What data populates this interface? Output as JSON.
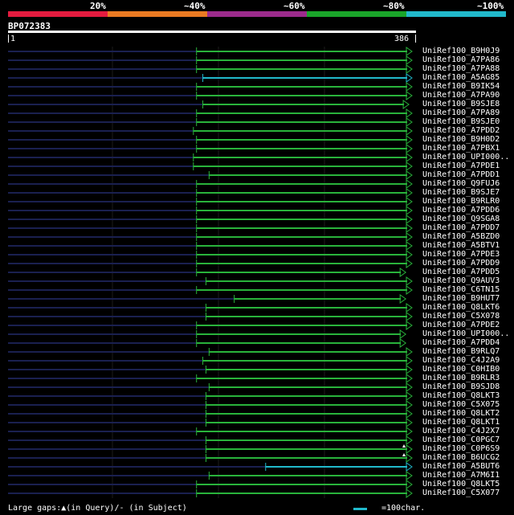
{
  "colors": {
    "scale": [
      "#e31b3f",
      "#ea7a22",
      "#9c2b8c",
      "#1aa52a",
      "#21b9cb"
    ],
    "hit_green": "#29b33b",
    "hit_cyan": "#21b9cb",
    "track": "#1a2050"
  },
  "scale_labels": [
    "20%",
    "~40%",
    "~60%",
    "~80%",
    "~100%"
  ],
  "query": {
    "id": "BP072383",
    "start": "1",
    "end": "386"
  },
  "hits": [
    {
      "name": "UniRef100_B9H0J9",
      "start": 181,
      "end": 386,
      "color": "green",
      "arrow": "right"
    },
    {
      "name": "UniRef100_A7PA86",
      "start": 181,
      "end": 386,
      "color": "green",
      "arrow": "right"
    },
    {
      "name": "UniRef100_A7PA88",
      "start": 181,
      "end": 386,
      "color": "green",
      "arrow": "right"
    },
    {
      "name": "UniRef100_A5AG85",
      "start": 187,
      "end": 386,
      "color": "cyan",
      "arrow": "right"
    },
    {
      "name": "UniRef100_B9IK54",
      "start": 181,
      "end": 386,
      "color": "green",
      "arrow": "right"
    },
    {
      "name": "UniRef100_A7PA90",
      "start": 181,
      "end": 386,
      "color": "green",
      "arrow": "right"
    },
    {
      "name": "UniRef100_B9SJE8",
      "start": 187,
      "end": 383,
      "color": "green",
      "arrow": "right"
    },
    {
      "name": "UniRef100_A7PA89",
      "start": 181,
      "end": 386,
      "color": "green",
      "arrow": "right"
    },
    {
      "name": "UniRef100_B9SJE0",
      "start": 181,
      "end": 386,
      "color": "green",
      "arrow": "right"
    },
    {
      "name": "UniRef100_A7PDD2",
      "start": 178,
      "end": 386,
      "color": "green",
      "arrow": "right"
    },
    {
      "name": "UniRef100_B9H0D2",
      "start": 181,
      "end": 386,
      "color": "green",
      "arrow": "right"
    },
    {
      "name": "UniRef100_A7PBX1",
      "start": 181,
      "end": 386,
      "color": "green",
      "arrow": "right"
    },
    {
      "name": "UniRef100_UPI000..",
      "start": 178,
      "end": 386,
      "color": "green",
      "arrow": "right"
    },
    {
      "name": "UniRef100_A7PDE1",
      "start": 178,
      "end": 386,
      "color": "green",
      "arrow": "right"
    },
    {
      "name": "UniRef100_A7PDD1",
      "start": 193,
      "end": 386,
      "color": "green",
      "arrow": "right"
    },
    {
      "name": "UniRef100_Q9FUJ6",
      "start": 181,
      "end": 386,
      "color": "green",
      "arrow": "right"
    },
    {
      "name": "UniRef100_B9SJE7",
      "start": 181,
      "end": 386,
      "color": "green",
      "arrow": "right"
    },
    {
      "name": "UniRef100_B9RLR0",
      "start": 181,
      "end": 386,
      "color": "green",
      "arrow": "right"
    },
    {
      "name": "UniRef100_A7PDD6",
      "start": 181,
      "end": 386,
      "color": "green",
      "arrow": "right"
    },
    {
      "name": "UniRef100_Q9SGA8",
      "start": 181,
      "end": 386,
      "color": "green",
      "arrow": "right"
    },
    {
      "name": "UniRef100_A7PDD7",
      "start": 181,
      "end": 386,
      "color": "green",
      "arrow": "right"
    },
    {
      "name": "UniRef100_A5BZD0",
      "start": 181,
      "end": 386,
      "color": "green",
      "arrow": "right"
    },
    {
      "name": "UniRef100_A5BTV1",
      "start": 181,
      "end": 386,
      "color": "green",
      "arrow": "right"
    },
    {
      "name": "UniRef100_A7PDE3",
      "start": 181,
      "end": 386,
      "color": "green",
      "arrow": "right"
    },
    {
      "name": "UniRef100_A7PDD9",
      "start": 181,
      "end": 386,
      "color": "green",
      "arrow": "right"
    },
    {
      "name": "UniRef100_A7PDD5",
      "start": 181,
      "end": 380,
      "color": "green",
      "arrow": "right"
    },
    {
      "name": "UniRef100_Q9AUV3",
      "start": 190,
      "end": 386,
      "color": "green",
      "arrow": "right"
    },
    {
      "name": "UniRef100_C6TN15",
      "start": 181,
      "end": 386,
      "color": "green",
      "arrow": "right"
    },
    {
      "name": "UniRef100_B9HUT7",
      "start": 217,
      "end": 380,
      "color": "green",
      "arrow": "right"
    },
    {
      "name": "UniRef100_Q8LKT6",
      "start": 190,
      "end": 386,
      "color": "green",
      "arrow": "right"
    },
    {
      "name": "UniRef100_C5X078",
      "start": 190,
      "end": 386,
      "color": "green",
      "arrow": "right"
    },
    {
      "name": "UniRef100_A7PDE2",
      "start": 181,
      "end": 386,
      "color": "green",
      "arrow": "right"
    },
    {
      "name": "UniRef100_UPI000..",
      "start": 181,
      "end": 380,
      "color": "green",
      "arrow": "right"
    },
    {
      "name": "UniRef100_A7PDD4",
      "start": 181,
      "end": 380,
      "color": "green",
      "arrow": "right"
    },
    {
      "name": "UniRef100_B9RLQ7",
      "start": 193,
      "end": 386,
      "color": "green",
      "arrow": "right"
    },
    {
      "name": "UniRef100_C4J2A9",
      "start": 187,
      "end": 386,
      "color": "green",
      "arrow": "right"
    },
    {
      "name": "UniRef100_C0HIB0",
      "start": 190,
      "end": 386,
      "color": "green",
      "arrow": "right"
    },
    {
      "name": "UniRef100_B9RLR3",
      "start": 181,
      "end": 386,
      "color": "green",
      "arrow": "right"
    },
    {
      "name": "UniRef100_B9SJD8",
      "start": 193,
      "end": 386,
      "color": "green",
      "arrow": "right"
    },
    {
      "name": "UniRef100_Q8LKT3",
      "start": 190,
      "end": 386,
      "color": "green",
      "arrow": "right"
    },
    {
      "name": "UniRef100_C5X075",
      "start": 190,
      "end": 386,
      "color": "green",
      "arrow": "right"
    },
    {
      "name": "UniRef100_Q8LKT2",
      "start": 190,
      "end": 386,
      "color": "green",
      "arrow": "right"
    },
    {
      "name": "UniRef100_Q8LKT1",
      "start": 190,
      "end": 386,
      "color": "green",
      "arrow": "right"
    },
    {
      "name": "UniRef100_C4J2X7",
      "start": 181,
      "end": 386,
      "color": "green",
      "arrow": "right"
    },
    {
      "name": "UniRef100_C0PGC7",
      "start": 190,
      "end": 386,
      "color": "green",
      "arrow": "right"
    },
    {
      "name": "UniRef100_C0P6S9",
      "start": 190,
      "end": 386,
      "color": "green",
      "arrow": "right",
      "gap_marker": true
    },
    {
      "name": "UniRef100_B6UCG2",
      "start": 190,
      "end": 386,
      "color": "green",
      "arrow": "right",
      "gap_marker": true
    },
    {
      "name": "UniRef100_A5BUT6",
      "start": 247,
      "end": 386,
      "color": "cyan",
      "arrow": "right"
    },
    {
      "name": "UniRef100_A7M6I1",
      "start": 193,
      "end": 386,
      "color": "green",
      "arrow": "right"
    },
    {
      "name": "UniRef100_Q8LKT5",
      "start": 181,
      "end": 386,
      "color": "green",
      "arrow": "right"
    },
    {
      "name": "UniRef100_C5X077",
      "start": 181,
      "end": 386,
      "color": "green",
      "arrow": "right"
    }
  ],
  "footer": {
    "legend": "Large gaps:▲(in Query)/- (in Subject)",
    "scale": "=100char."
  }
}
